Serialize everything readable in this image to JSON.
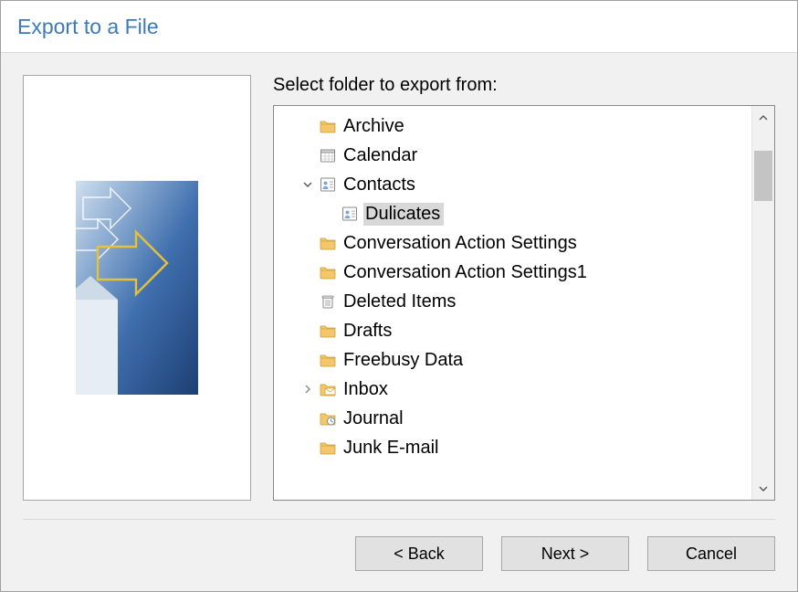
{
  "window": {
    "title": "Export to a File"
  },
  "instruction": "Select folder to export from:",
  "tree": {
    "items": [
      {
        "label": "Archive",
        "depth": 1,
        "icon": "folder",
        "expander": "",
        "selected": false
      },
      {
        "label": "Calendar",
        "depth": 1,
        "icon": "calendar",
        "expander": "",
        "selected": false
      },
      {
        "label": "Contacts",
        "depth": 1,
        "icon": "contacts",
        "expander": "v",
        "selected": false
      },
      {
        "label": "Dulicates",
        "depth": 2,
        "icon": "contacts",
        "expander": "",
        "selected": true
      },
      {
        "label": "Conversation Action Settings",
        "depth": 1,
        "icon": "folder",
        "expander": "",
        "selected": false
      },
      {
        "label": "Conversation Action Settings1",
        "depth": 1,
        "icon": "folder",
        "expander": "",
        "selected": false
      },
      {
        "label": "Deleted Items",
        "depth": 1,
        "icon": "trash",
        "expander": "",
        "selected": false
      },
      {
        "label": "Drafts",
        "depth": 1,
        "icon": "folder",
        "expander": "",
        "selected": false
      },
      {
        "label": "Freebusy Data",
        "depth": 1,
        "icon": "folder",
        "expander": "",
        "selected": false
      },
      {
        "label": "Inbox",
        "depth": 1,
        "icon": "inbox",
        "expander": ">",
        "selected": false
      },
      {
        "label": "Journal",
        "depth": 1,
        "icon": "journal",
        "expander": "",
        "selected": false
      },
      {
        "label": "Junk E-mail",
        "depth": 1,
        "icon": "folder",
        "expander": "",
        "selected": false
      }
    ]
  },
  "buttons": {
    "back": "< Back",
    "next": "Next >",
    "cancel": "Cancel"
  }
}
